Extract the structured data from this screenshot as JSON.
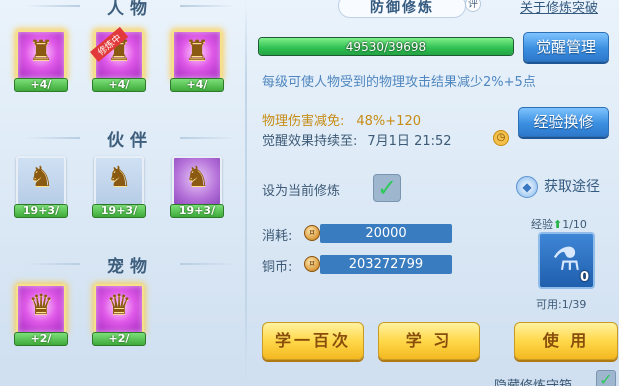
{
  "left": {
    "sections": {
      "characters": "人物",
      "partners": "伙伴",
      "pets": "宠物"
    },
    "characters": [
      {
        "count": "+4/",
        "icon": "warrior-statue-icon",
        "ribbon": ""
      },
      {
        "count": "+4/",
        "icon": "warrior-statue-icon",
        "ribbon": "修炼中"
      },
      {
        "count": "+4/",
        "icon": "warrior-statue-icon",
        "ribbon": ""
      }
    ],
    "partners": [
      {
        "count": "19+3/",
        "icon": "lion-warrior-icon"
      },
      {
        "count": "19+3/",
        "icon": "lion-warrior-icon"
      },
      {
        "count": "19+3/",
        "icon": "lion-warrior-icon"
      }
    ],
    "pets": [
      {
        "count": "+2/",
        "icon": "cat-pet-icon"
      },
      {
        "count": "+2/",
        "icon": "cat-pet-icon"
      }
    ]
  },
  "header": {
    "tag": "防御修炼",
    "eval_badge": "评",
    "breakthrough_link": "关于修炼突破"
  },
  "progress": {
    "text": "49530/39698",
    "fraction": 1.0
  },
  "buttons": {
    "awaken_manage": "觉醒管理",
    "exp_exchange": "经验换修",
    "learn_100": "学一百次",
    "learn": "学 习",
    "use": "使 用"
  },
  "description": "每级可使人物受到的物理攻击结果减少2%+5点",
  "stats": {
    "phys_reduce_label": "物理伤害减免:",
    "phys_reduce_value": "48%+120",
    "awaken_duration_label": "觉醒效果持续至:",
    "awaken_duration_value": "7月1日 21:52"
  },
  "set_current": {
    "label": "设为当前修炼",
    "checked": true
  },
  "get_way": "获取途径",
  "cost": {
    "consume_label": "消耗:",
    "consume_value": "20000",
    "coins_label": "铜币:",
    "coins_value": "203272799"
  },
  "exp_item": {
    "label": "经验",
    "count": "1/10",
    "stack": "0",
    "usable": "可用:1/39"
  },
  "bottom": {
    "hide_label": "隐藏修炼守箱"
  },
  "colors": {
    "accent_blue": "#3b8fe0",
    "button_yellow": "#ffd84a",
    "progress_green": "#2fbf52",
    "gold_text": "#c78c14"
  }
}
